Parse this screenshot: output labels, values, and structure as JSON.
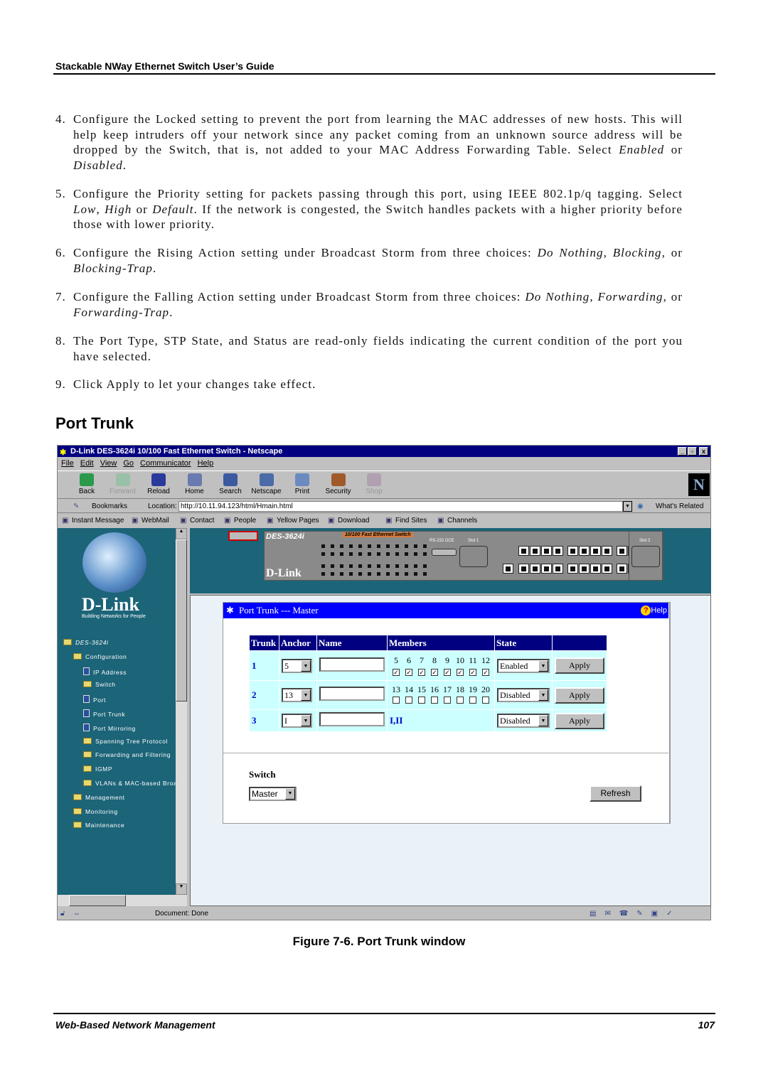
{
  "header": {
    "title": "Stackable NWay Ethernet Switch User’s Guide"
  },
  "steps": [
    {
      "num": "4.",
      "segments": [
        {
          "t": "Configure the Locked setting to prevent the port from learning the MAC addresses of new hosts. This will help keep intruders off your network since any packet coming from an unknown source address will be dropped by the Switch, that is, not added to your MAC Address Forwarding Table. Select "
        },
        {
          "t": "Enabled",
          "i": true
        },
        {
          "t": " or "
        },
        {
          "t": "Disabled",
          "i": true
        },
        {
          "t": "."
        }
      ]
    },
    {
      "num": "5.",
      "segments": [
        {
          "t": "Configure the Priority setting for packets passing through this port, using IEEE 802.1p/q tagging. Select "
        },
        {
          "t": "Low",
          "i": true
        },
        {
          "t": ", "
        },
        {
          "t": "High",
          "i": true
        },
        {
          "t": " or "
        },
        {
          "t": "Default",
          "i": true
        },
        {
          "t": ". If the network is congested, the Switch handles packets with a higher priority before those with lower priority."
        }
      ]
    },
    {
      "num": "6.",
      "segments": [
        {
          "t": "Configure the Rising Action setting under Broadcast Storm from three choices: "
        },
        {
          "t": "Do Nothing",
          "i": true
        },
        {
          "t": ", "
        },
        {
          "t": "Blocking",
          "i": true
        },
        {
          "t": ", or "
        },
        {
          "t": "Blocking-Trap",
          "i": true
        },
        {
          "t": "."
        }
      ]
    },
    {
      "num": "7.",
      "segments": [
        {
          "t": "Configure the Falling Action setting under Broadcast Storm from three choices: "
        },
        {
          "t": "Do Nothing",
          "i": true
        },
        {
          "t": ", "
        },
        {
          "t": "Forwarding",
          "i": true
        },
        {
          "t": ", or "
        },
        {
          "t": "Forwarding-Trap",
          "i": true
        },
        {
          "t": "."
        }
      ]
    },
    {
      "num": "8.",
      "segments": [
        {
          "t": "The Port Type, STP State, and Status are read-only fields indicating the current condition of the port you have selected."
        }
      ]
    },
    {
      "num": "9.",
      "segments": [
        {
          "t": "Click Apply to let your changes take effect."
        }
      ]
    }
  ],
  "section_title": "Port Trunk",
  "browser": {
    "title": "D-Link DES-3624i 10/100 Fast Ethernet Switch - Netscape",
    "menu": [
      "File",
      "Edit",
      "View",
      "Go",
      "Communicator",
      "Help"
    ],
    "toolbar": [
      {
        "label": "Back",
        "icon": "back-arrow-icon",
        "color": "#2a9a4a",
        "enabled": true
      },
      {
        "label": "Forward",
        "icon": "forward-arrow-icon",
        "color": "#9ac0a8",
        "enabled": false
      },
      {
        "label": "Reload",
        "icon": "reload-icon",
        "color": "#2a3a9a",
        "enabled": true
      },
      {
        "label": "Home",
        "icon": "home-icon",
        "color": "#6a7ab0",
        "enabled": true
      },
      {
        "label": "Search",
        "icon": "search-icon",
        "color": "#3a5aa0",
        "enabled": true
      },
      {
        "label": "Netscape",
        "icon": "netscape-icon",
        "color": "#4a6aa8",
        "enabled": true
      },
      {
        "label": "Print",
        "icon": "print-icon",
        "color": "#6a8ac0",
        "enabled": true
      },
      {
        "label": "Security",
        "icon": "lock-icon",
        "color": "#a05a2a",
        "enabled": true
      },
      {
        "label": "Shop",
        "icon": "shop-icon",
        "color": "#b0a0b0",
        "enabled": false
      }
    ],
    "bookmarks": "Bookmarks",
    "location_label": "Location:",
    "url": "http://10.11.94.123/html/Hmain.html",
    "whats_related": "What's Related",
    "personal": [
      "Instant Message",
      "WebMail",
      "Contact",
      "People",
      "Yellow Pages",
      "Download",
      "Find Sites",
      "Channels"
    ],
    "status": "Document: Done"
  },
  "sidebar": {
    "brand": "D-Link",
    "tagline": "Building Networks for People",
    "items": [
      {
        "label": "DES-3624i",
        "icon": "folder",
        "level": 0
      },
      {
        "label": "Configuration",
        "icon": "folder",
        "level": 1
      },
      {
        "label": "IP Address",
        "icon": "page",
        "level": 2
      },
      {
        "label": "Switch",
        "icon": "folder",
        "level": 2
      },
      {
        "label": "Port",
        "icon": "page",
        "level": 2
      },
      {
        "label": "Port Trunk",
        "icon": "page",
        "level": 2
      },
      {
        "label": "Port Mirroring",
        "icon": "page",
        "level": 2
      },
      {
        "label": "Spanning Tree Protocol",
        "icon": "folder",
        "level": 2
      },
      {
        "label": "Forwarding and Filtering",
        "icon": "folder",
        "level": 2
      },
      {
        "label": "IGMP",
        "icon": "folder",
        "level": 2
      },
      {
        "label": "VLANs & MAC-based Broa",
        "icon": "folder",
        "level": 2
      },
      {
        "label": "Management",
        "icon": "folder",
        "level": 1
      },
      {
        "label": "Monitoring",
        "icon": "folder",
        "level": 1
      },
      {
        "label": "Maintenance",
        "icon": "folder",
        "level": 1
      }
    ]
  },
  "device": {
    "model": "DES-3624i",
    "subtitle": "10/100 Fast Ethernet Switch",
    "brand": "D-Link",
    "slot1": "Slot 1",
    "slot2": "Slot 2",
    "console": "RS-232 DCE"
  },
  "panel": {
    "title": "Port Trunk --- Master",
    "help": "Help",
    "columns": [
      "Trunk",
      "Anchor",
      "Name",
      "Members",
      "State",
      ""
    ],
    "rows": [
      {
        "trunk": "1",
        "anchor": "5",
        "name": "",
        "members": [
          "5",
          "6",
          "7",
          "8",
          "9",
          "10",
          "11",
          "12"
        ],
        "checked": [
          true,
          true,
          true,
          true,
          true,
          true,
          true,
          true
        ],
        "state": "Enabled",
        "apply": "Apply"
      },
      {
        "trunk": "2",
        "anchor": "13",
        "name": "",
        "members": [
          "13",
          "14",
          "15",
          "16",
          "17",
          "18",
          "19",
          "20"
        ],
        "checked": [
          false,
          false,
          false,
          false,
          false,
          false,
          false,
          false
        ],
        "state": "Disabled",
        "apply": "Apply"
      },
      {
        "trunk": "3",
        "anchor": "I",
        "name": "",
        "members_text": "I,II",
        "state": "Disabled",
        "apply": "Apply"
      }
    ],
    "switch_label": "Switch",
    "switch_value": "Master",
    "refresh": "Refresh"
  },
  "caption": "Figure 7-6.  Port Trunk window",
  "footer": {
    "left": "Web-Based Network Management",
    "page": "107"
  }
}
